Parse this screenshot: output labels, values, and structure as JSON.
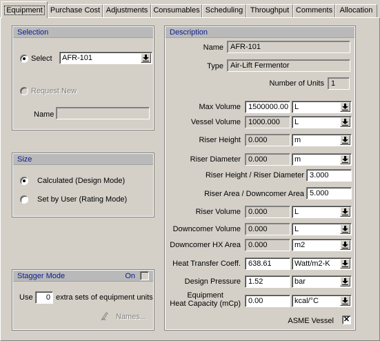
{
  "tabs": [
    {
      "label": "Equipment",
      "active": true
    },
    {
      "label": "Purchase Cost"
    },
    {
      "label": "Adjustments"
    },
    {
      "label": "Consumables"
    },
    {
      "label": "Scheduling"
    },
    {
      "label": "Throughput"
    },
    {
      "label": "Comments"
    },
    {
      "label": "Allocation"
    }
  ],
  "selection": {
    "header": "Selection",
    "select_label": "Select",
    "select_value": "AFR-101",
    "request_label": "Request New",
    "name_label": "Name",
    "name_value": ""
  },
  "size": {
    "header": "Size",
    "calculated_label": "Calculated (Design Mode)",
    "user_label": "Set by User (Rating Mode)",
    "selected": "calculated"
  },
  "stagger": {
    "header": "Stagger Mode",
    "on_label": "On",
    "use_label": "Use",
    "sets_value": "0",
    "sets_label": "extra sets of equipment units",
    "names_label": "Names..."
  },
  "description": {
    "header": "Description",
    "name_label": "Name",
    "name_value": "AFR-101",
    "type_label": "Type",
    "type_value": "Air-Lift Fermentor",
    "units_label": "Number of Units",
    "units_value": "1",
    "rows": [
      {
        "label": "Max Volume",
        "value": "1500000.00",
        "unit": "L"
      },
      {
        "label": "Vessel Volume",
        "value": "1000.000",
        "unit": "L"
      },
      {
        "label": "Riser Height",
        "value": "0.000",
        "unit": "m"
      },
      {
        "label": "Riser Diameter",
        "value": "0.000",
        "unit": "m"
      },
      {
        "label": "Riser Height / Riser Diameter",
        "value": "3.000"
      },
      {
        "label": "Riser Area / Downcomer Area",
        "value": "5.000"
      },
      {
        "label": "Riser Volume",
        "value": "0.000",
        "unit": "L"
      },
      {
        "label": "Downcomer Volume",
        "value": "0.000",
        "unit": "L"
      },
      {
        "label": "Downcomer HX Area",
        "value": "0.000",
        "unit": "m2"
      },
      {
        "label": "Heat Transfer Coeff.",
        "value": "638.61",
        "unit": "Watt/m2-K"
      },
      {
        "label": "Design Pressure",
        "value": "1.52",
        "unit": "bar"
      },
      {
        "label": "Equipment\nHeat Capacity (mCp)",
        "value": "0.00",
        "unit": "kcal/°C"
      }
    ],
    "asme_label": "ASME Vessel",
    "asme_checked": "✕"
  }
}
